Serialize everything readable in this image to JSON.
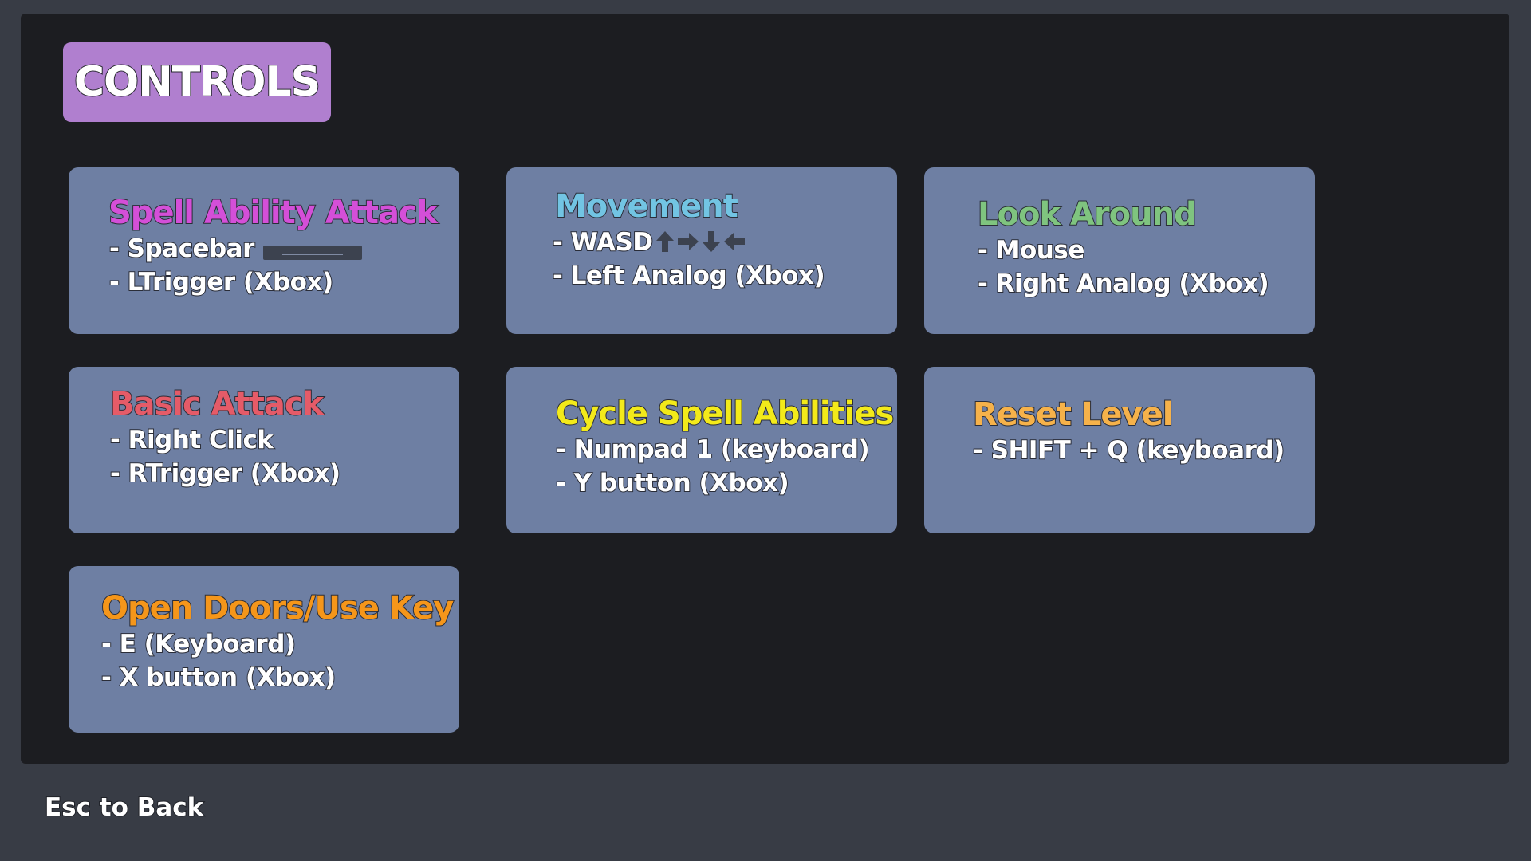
{
  "screen_title": "CONTROLS",
  "back_hint": "Esc to Back",
  "cards": {
    "spell_ability_attack": {
      "title": "Spell Ability Attack",
      "color": "#d44fd8",
      "lines": [
        "- Spacebar",
        "- LTrigger (Xbox)"
      ],
      "icon": "spacebar-key-icon"
    },
    "movement": {
      "title": "Movement",
      "color": "#72c4e3",
      "lines": [
        "- WASD",
        "- Left Analog (Xbox)"
      ],
      "icons": [
        "arrow-up-icon",
        "arrow-right-icon",
        "arrow-down-icon",
        "arrow-left-icon"
      ]
    },
    "look_around": {
      "title": "Look Around",
      "color": "#7fc47f",
      "lines": [
        "- Mouse",
        "- Right Analog (Xbox)"
      ]
    },
    "basic_attack": {
      "title": "Basic Attack",
      "color": "#e55b68",
      "lines": [
        "- Right Click",
        "- RTrigger (Xbox)"
      ]
    },
    "cycle_spell_abilities": {
      "title": "Cycle Spell Abilities",
      "color": "#f3ea1a",
      "lines": [
        "- Numpad 1 (keyboard)",
        "- Y button  (Xbox)"
      ]
    },
    "reset_level": {
      "title": "Reset Level",
      "color": "#f6b24a",
      "lines": [
        "- SHIFT + Q (keyboard)"
      ]
    },
    "open_doors": {
      "title": "Open Doors/Use Key",
      "color": "#f5961a",
      "lines": [
        "- E (Keyboard)",
        "- X button (Xbox)"
      ]
    }
  }
}
